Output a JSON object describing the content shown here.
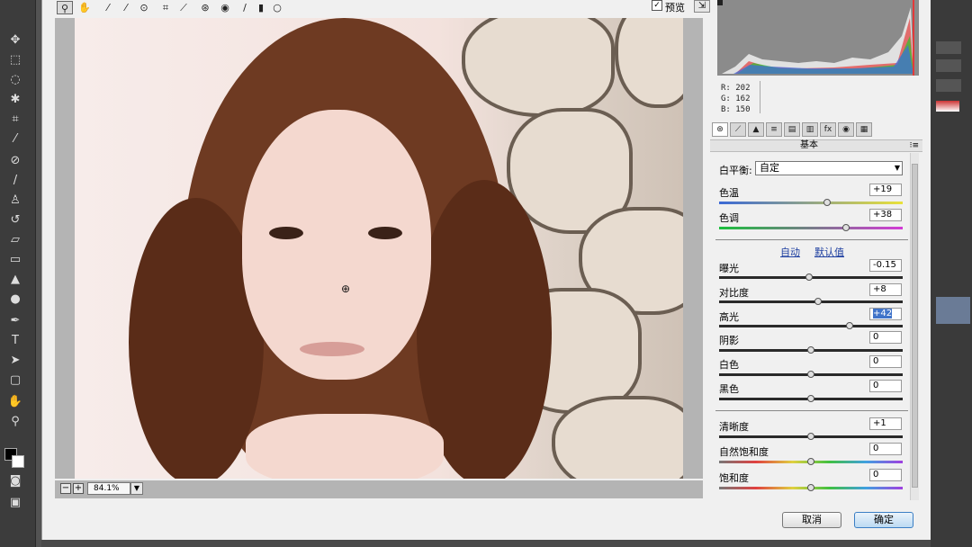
{
  "preview": {
    "checked": true,
    "label": "预览"
  },
  "statusbar": {
    "zoom": "84.1%"
  },
  "readout": {
    "r": "R: 202",
    "g": "G: 162",
    "b": "B: 150"
  },
  "panel": {
    "title": "基本"
  },
  "white_balance": {
    "label": "白平衡:",
    "value": "自定"
  },
  "auto_links": {
    "auto": "自动",
    "default": "默认值"
  },
  "sliders": [
    {
      "label": "色温",
      "value": "+19",
      "level": 0.59
    },
    {
      "label": "色调",
      "value": "+38",
      "level": 0.69
    },
    {
      "label": "曝光",
      "value": "-0.15",
      "level": 0.49
    },
    {
      "label": "对比度",
      "value": "+8",
      "level": 0.54
    },
    {
      "label": "高光",
      "value": "+42",
      "level": 0.71
    },
    {
      "label": "阴影",
      "value": "0",
      "level": 0.5
    },
    {
      "label": "白色",
      "value": "0",
      "level": 0.5
    },
    {
      "label": "黑色",
      "value": "0",
      "level": 0.5
    },
    {
      "label": "清晰度",
      "value": "+1",
      "level": 0.5
    },
    {
      "label": "自然饱和度",
      "value": "0",
      "level": 0.5
    },
    {
      "label": "饱和度",
      "value": "0",
      "level": 0.5
    }
  ],
  "buttons": {
    "cancel": "取消",
    "ok": "确定"
  },
  "colors": {
    "accent": "#3b7fc4",
    "photo_hair": "#6e3a22",
    "skin": "#f4d8cf"
  },
  "icons": [
    "zoom-icon",
    "hand-icon",
    "white-balance-icon",
    "color-sampler-icon",
    "target-adjust-icon",
    "crop-icon",
    "straighten-icon",
    "spot-removal-icon",
    "red-eye-icon",
    "brush-icon",
    "graduated-filter-icon",
    "radial-filter-icon"
  ]
}
